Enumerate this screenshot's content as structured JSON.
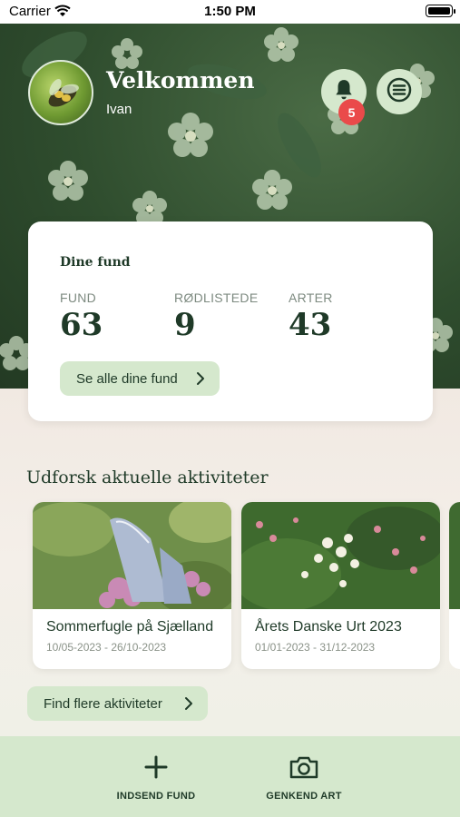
{
  "status_bar": {
    "carrier": "Carrier",
    "time": "1:50 PM"
  },
  "header": {
    "welcome": "Velkommen",
    "username": "Ivan",
    "notification_count": "5",
    "icons": {
      "notifications": "bell-icon",
      "menu": "menu-icon"
    }
  },
  "finds_card": {
    "title": "Dine fund",
    "stats": [
      {
        "label": "FUND",
        "value": "63"
      },
      {
        "label": "RØDLISTEDE",
        "value": "9"
      },
      {
        "label": "ARTER",
        "value": "43"
      }
    ],
    "see_all_label": "Se alle dine fund"
  },
  "activities": {
    "title": "Udforsk aktuelle aktiviteter",
    "items": [
      {
        "title": "Sommerfugle på Sjælland",
        "dates": "10/05-2023 - 26/10-2023"
      },
      {
        "title": "Årets Danske Urt 2023",
        "dates": "01/01-2023 - 31/12-2023"
      }
    ],
    "more_label": "Find flere aktiviteter"
  },
  "bottom_nav": {
    "submit_label": "INDSEND FUND",
    "recognize_label": "GENKEND ART"
  },
  "colors": {
    "accent": "#d5e8cd",
    "text_dark": "#1f3a28",
    "badge": "#ea4a4a"
  }
}
